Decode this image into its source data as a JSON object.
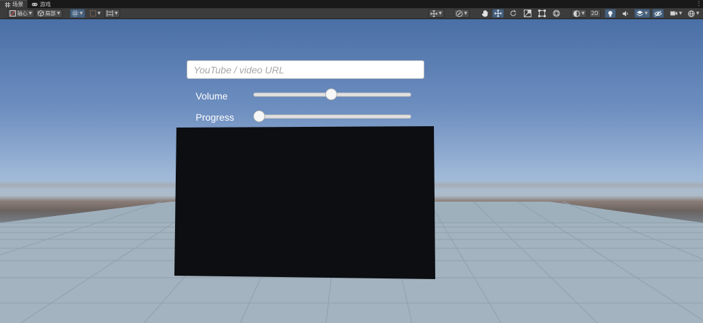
{
  "tabs": [
    {
      "label": "场景",
      "icon": "grid-icon",
      "active": true
    },
    {
      "label": "游戏",
      "icon": "gamepad-icon",
      "active": false
    }
  ],
  "toolbar": {
    "pivot_label": "轴心",
    "local_label": "局部",
    "mode_2d_label": "2D"
  },
  "video_ui": {
    "url_placeholder": "YouTube / video URL",
    "url_value": "",
    "volume_label": "Volume",
    "volume_value": 0.49,
    "progress_label": "Progress",
    "progress_value": 0.0
  },
  "colors": {
    "toolbar_active": "#46607c",
    "video_screen": "#0c0e12"
  }
}
